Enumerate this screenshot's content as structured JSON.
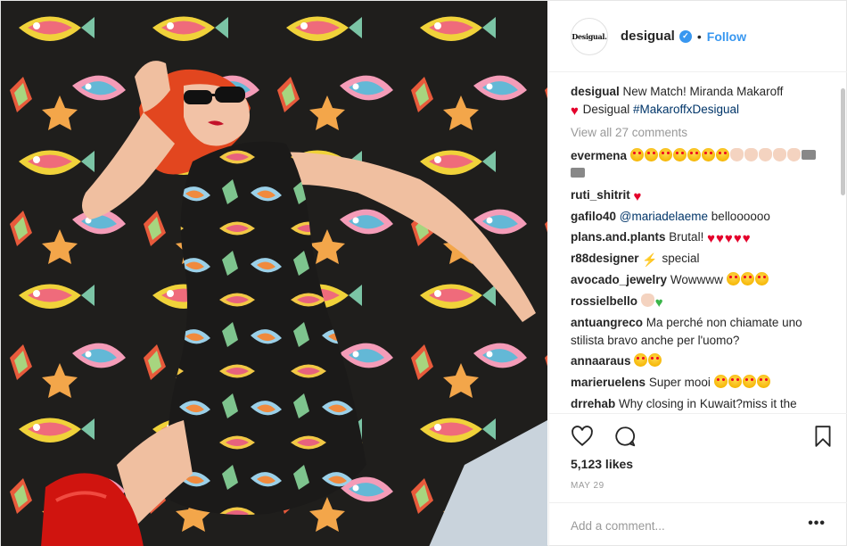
{
  "post": {
    "username": "desigual",
    "avatar_text": "Desigual.",
    "follow_label": "Follow",
    "separator": "•",
    "caption": {
      "text": "New Match! Miranda Makaroff",
      "line2_brand": "Desigual",
      "hashtag": "#MakaroffxDesigual"
    },
    "view_all_label": "View all 27 comments",
    "comments": [
      {
        "user": "evermena",
        "text": "",
        "emojis": [
          "face",
          "face",
          "face",
          "face",
          "face",
          "face",
          "face",
          "clap",
          "clap",
          "clap",
          "clap",
          "clap",
          "cam",
          "cam"
        ]
      },
      {
        "user": "ruti_shitrit",
        "text": "",
        "emojis": [
          "heart"
        ]
      },
      {
        "user": "gafilo40",
        "mention": "@mariadelaeme",
        "text": "belloooooo",
        "emojis": []
      },
      {
        "user": "plans.and.plants",
        "text": "Brutal!",
        "emojis": [
          "heart",
          "heart",
          "heart",
          "heart",
          "heart"
        ]
      },
      {
        "user": "r88designer",
        "text": "special",
        "emojis_before": [
          "bolt"
        ],
        "emojis": []
      },
      {
        "user": "avocado_jewelry",
        "text": "Wowwww",
        "emojis": [
          "face",
          "face",
          "face"
        ]
      },
      {
        "user": "rossielbello",
        "text": "",
        "emojis": [
          "clap",
          "green"
        ]
      },
      {
        "user": "antuangreco",
        "text": "Ma perché non chiamate uno stilista bravo anche per l'uomo?",
        "emojis": []
      },
      {
        "user": "annaaraus",
        "text": "",
        "emojis": [
          "face",
          "face"
        ]
      },
      {
        "user": "marieruelens",
        "text": "Super mooi",
        "emojis": [
          "face",
          "face",
          "face",
          "face"
        ]
      },
      {
        "user": "drrehab",
        "text": "Why closing in Kuwait?miss it the",
        "emojis": []
      }
    ],
    "likes": "5,123 likes",
    "date": "MAY 29",
    "add_comment_placeholder": "Add a comment...",
    "more_label": "•••"
  },
  "icons": {
    "like": "heart-outline-icon",
    "comment": "speech-bubble-icon",
    "save": "bookmark-icon",
    "verified": "verified-badge-icon"
  },
  "colors": {
    "link_blue": "#3897f0",
    "hashtag": "#003569",
    "muted": "#999999",
    "heart_red": "#e4002b"
  }
}
